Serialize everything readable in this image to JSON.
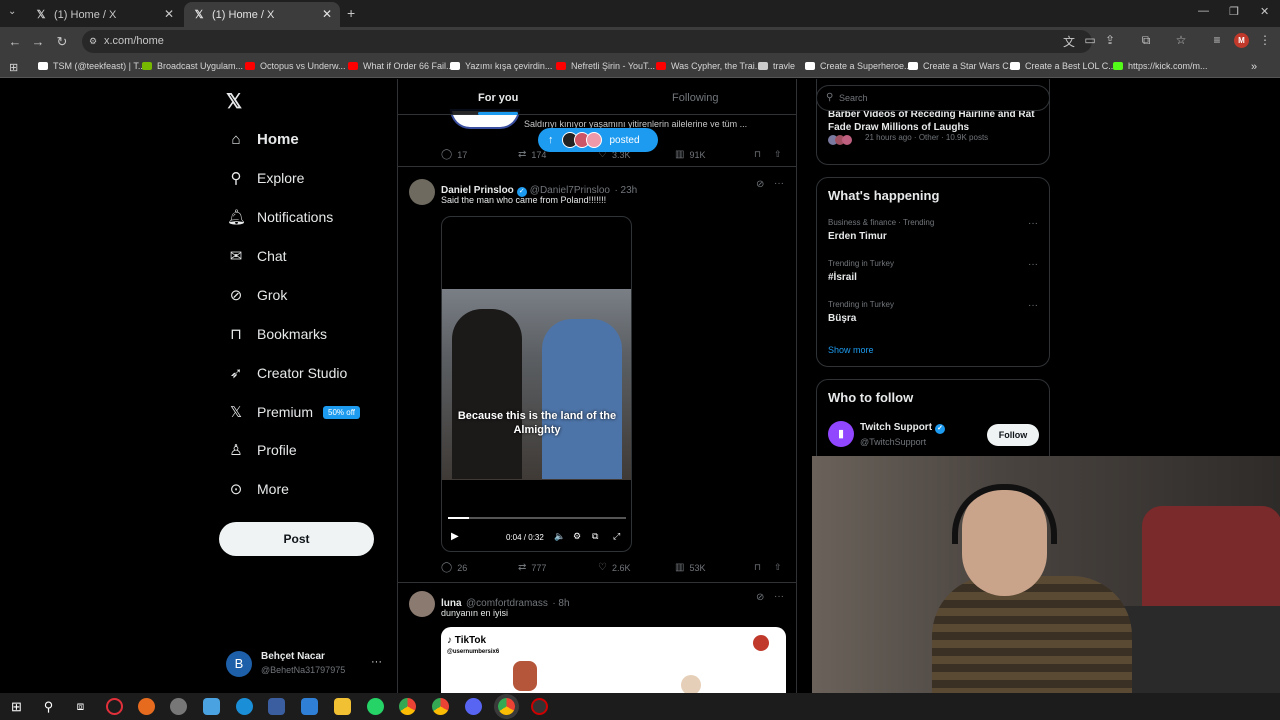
{
  "tabs": [
    {
      "label": "(1) Home / X"
    },
    {
      "label": "(1) Home / X"
    }
  ],
  "url": "x.com/home",
  "bookmarks": [
    {
      "label": "TSM (@teekfeast) | T...",
      "color": "#ffffff"
    },
    {
      "label": "Broadcast Uygulam...",
      "color": "#76b900"
    },
    {
      "label": "Octopus vs Underw...",
      "color": "#ff0000"
    },
    {
      "label": "What if Order 66 Fail...",
      "color": "#ff0000"
    },
    {
      "label": "Yazımı kışa çevirdin...",
      "color": "#ffffff"
    },
    {
      "label": "Nefretli Şirin - YouT...",
      "color": "#ff0000"
    },
    {
      "label": "Was Cypher, the Trai...",
      "color": "#ff0000"
    },
    {
      "label": "travle",
      "color": "#cccccc"
    },
    {
      "label": "Create a Superheroe...",
      "color": "#ffffff"
    },
    {
      "label": "Create a Star Wars C...",
      "color": "#ffffff"
    },
    {
      "label": "Create a Best LOL C...",
      "color": "#ffffff"
    },
    {
      "label": "https://kick.com/m...",
      "color": "#53fc18"
    }
  ],
  "sidebar": {
    "items": [
      {
        "label": "Home",
        "icon": "home-icon"
      },
      {
        "label": "Explore",
        "icon": "search-icon"
      },
      {
        "label": "Notifications",
        "icon": "bell-icon"
      },
      {
        "label": "Chat",
        "icon": "mail-icon"
      },
      {
        "label": "Grok",
        "icon": "grok-icon"
      },
      {
        "label": "Bookmarks",
        "icon": "bookmark-icon"
      },
      {
        "label": "Creator Studio",
        "icon": "rocket-icon"
      },
      {
        "label": "Premium",
        "icon": "x-icon"
      },
      {
        "label": "Profile",
        "icon": "person-icon"
      },
      {
        "label": "More",
        "icon": "more-circle-icon"
      }
    ],
    "premium_badge": "50% off",
    "post_label": "Post",
    "account": {
      "initial": "B",
      "name": "Behçet Nacar",
      "handle": "@BehetNa31797975"
    }
  },
  "timeline": {
    "tabs": [
      "For you",
      "Following"
    ],
    "posted_pill": "posted",
    "top_tweet": {
      "text": "Saldırıyı kınıyor yaşamını yitirenlerin ailelerine ve tüm ...",
      "replies": "17",
      "reposts": "174",
      "likes": "3.3K",
      "views": "91K"
    },
    "tweet1": {
      "name": "Daniel Prinsloo",
      "handle": "@Daniel7Prinsloo",
      "time": "· 23h",
      "text": "Said the man who came from Poland!!!!!!!",
      "caption": "Because this is the land of the Almighty",
      "video_time": "0:04 / 0:32",
      "replies": "26",
      "reposts": "777",
      "likes": "2.6K",
      "views": "53K",
      "progress": 0.12
    },
    "tweet2": {
      "name": "luna",
      "handle": "@comfortdramass",
      "time": "· 8h",
      "text": "dunyanın en iyisi",
      "media_brand": "TikTok",
      "media_handle": "@usernumbersix6"
    }
  },
  "right": {
    "search_placeholder": "Search",
    "top_item": {
      "title": "Barber Videos of Receding Hairline and Rat Fade Draw Millions of Laughs",
      "meta": "21 hours ago · Other · 10.9K posts"
    },
    "whats_happening": "What's happening",
    "trends": [
      {
        "meta": "Business & finance · Trending",
        "name": "Erden Timur"
      },
      {
        "meta": "Trending in Turkey",
        "name": "#İsrail"
      },
      {
        "meta": "Trending in Turkey",
        "name": "Büşra"
      }
    ],
    "show_more": "Show more",
    "who_to_follow": "Who to follow",
    "follow": {
      "name": "Twitch Support",
      "handle": "@TwitchSupport",
      "button": "Follow"
    }
  }
}
